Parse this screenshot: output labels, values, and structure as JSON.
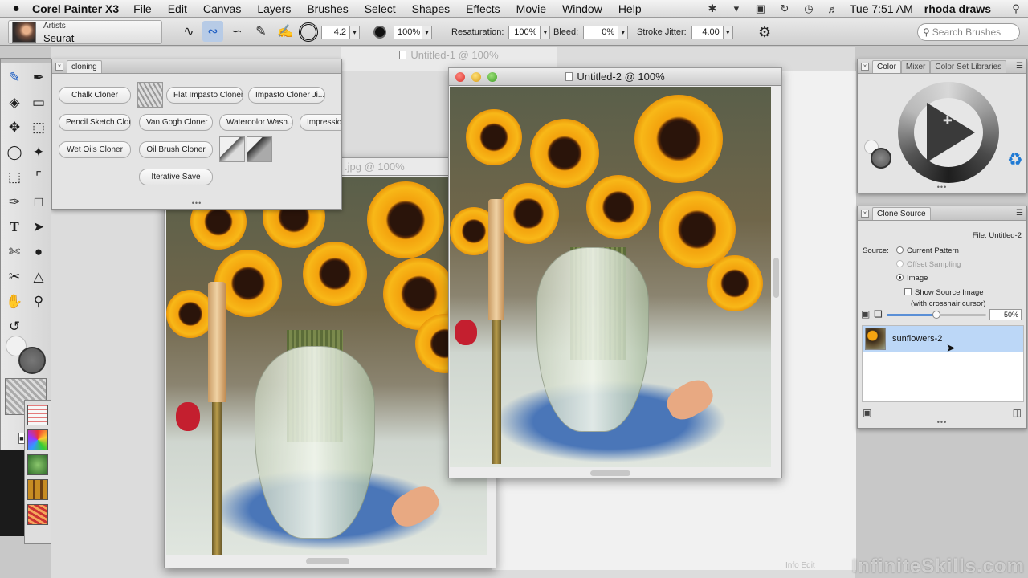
{
  "menubar": {
    "apple": "",
    "app_name": "Corel Painter X3",
    "items": [
      "File",
      "Edit",
      "Canvas",
      "Layers",
      "Brushes",
      "Select",
      "Shapes",
      "Effects",
      "Movie",
      "Window",
      "Help"
    ],
    "clock": "Tue 7:51 AM",
    "user": "rhoda draws"
  },
  "propbar": {
    "brush_category": "Artists",
    "brush_variant": "Seurat",
    "size_value": "4.2",
    "opacity_value": "100%",
    "resaturation_label": "Resaturation:",
    "resaturation_value": "100%",
    "bleed_label": "Bleed:",
    "bleed_value": "0%",
    "stroke_jitter_label": "Stroke Jitter:",
    "stroke_jitter_value": "4.00",
    "search_placeholder": "Search Brushes"
  },
  "cloning_panel": {
    "title": "cloning",
    "buttons": [
      "Chalk Cloner",
      "Flat Impasto Cloner",
      "Impasto Cloner Ji...",
      "Pencil Sketch Cloner",
      "Van Gogh Cloner",
      "Watercolor Wash...",
      "Impressio",
      "Wet Oils Cloner",
      "Oil Brush Cloner",
      "Iterative Save"
    ]
  },
  "documents": {
    "back_title": "Untitled-1 @ 100%",
    "mid_title": ".jpg @ 100%",
    "front_title": "Untitled-2 @ 100%"
  },
  "color_panel": {
    "tabs": [
      "Color",
      "Mixer",
      "Color Set Libraries"
    ]
  },
  "clone_source": {
    "title": "Clone Source",
    "file_label": "File: Untitled-2",
    "source_label": "Source:",
    "opt_current_pattern": "Current Pattern",
    "opt_offset_sampling": "Offset Sampling",
    "opt_image": "Image",
    "show_source_label": "Show Source Image",
    "crosshair_label": "(with crosshair cursor)",
    "opacity_value": "50%",
    "opacity_fraction": 0.5,
    "selected_source": "sunflowers-2"
  },
  "bottom": {
    "hint": "Info   Edit",
    "watermark": "InfiniteSkills.com"
  },
  "colors": {
    "accent_blue": "#1f7ad4",
    "selection": "#bcd7f7"
  }
}
